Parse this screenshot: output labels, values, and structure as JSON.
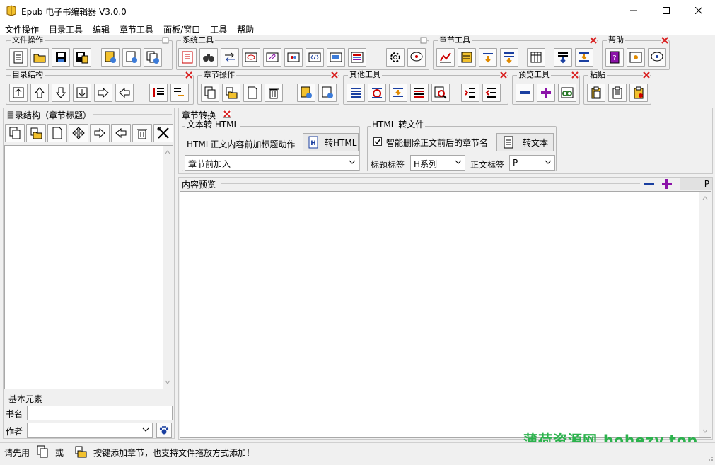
{
  "window": {
    "title": "Epub 电子书编辑器 V3.0.0"
  },
  "menu": [
    "文件操作",
    "目录工具",
    "编辑",
    "章节工具",
    "面板/窗口",
    "工具",
    "帮助"
  ],
  "toolbars": {
    "file_ops": "文件操作",
    "system_tools": "系统工具",
    "chapter_tools": "章节工具",
    "help": "帮助",
    "toc_structure": "目录结构",
    "chapter_ops": "章节操作",
    "other_tools": "其他工具",
    "preview_tools": "预览工具",
    "paste": "粘贴"
  },
  "left_panel": {
    "title": "目录结构（章节标题）",
    "basic_elements": "基本元素",
    "book_name_label": "书名",
    "book_name_value": "",
    "author_label": "作者",
    "author_value": ""
  },
  "chapter_convert": {
    "title": "章节转换",
    "text_to_html_group": "文本转 HTML",
    "html_action_label": "HTML正文内容前加标题动作",
    "to_html_button": "转HTML",
    "insert_mode_value": "章节前加入",
    "html_to_text_group": "HTML 转文件",
    "smart_delete_label": "智能删除正文前后的章节名",
    "smart_delete_checked": true,
    "to_text_button": "转文本",
    "heading_tag_label": "标题标签",
    "heading_tag_value": "H系列",
    "body_tag_label": "正文标签",
    "body_tag_value": "P"
  },
  "preview": {
    "title": "内容预览",
    "tag_indicator": "P"
  },
  "status": {
    "part1": "请先用",
    "part2": "或",
    "part3": "按键添加章节，也支持文件拖放方式添加！"
  },
  "watermark": "薄荷资源网 bohezy.top",
  "colors": {
    "accent_red": "#d82020",
    "accent_blue": "#1a3fa0",
    "accent_purple": "#8b13a8",
    "watermark_green": "#2bb24c"
  }
}
